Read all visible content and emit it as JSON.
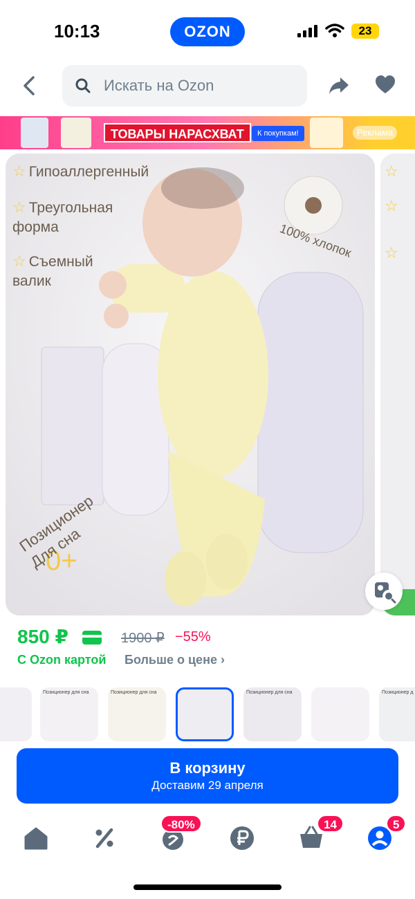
{
  "status_bar": {
    "time": "10:13",
    "brand": "OZON",
    "battery": "23"
  },
  "search": {
    "placeholder": "Искать на Ozon"
  },
  "banner": {
    "headline": "ТОВАРЫ НАРАСХВАТ",
    "cta": "К покупкам!",
    "ad_label": "Реклама"
  },
  "photo": {
    "features": [
      "Гипоаллергенный",
      "Треугольная форма",
      "Съемный валик"
    ],
    "badge_cotton": "100% хлопок",
    "badge_age": "0+",
    "badge_caption": "Позиционер Для сна"
  },
  "price": {
    "current": "850 ₽",
    "old": "1900 ₽",
    "discount": "−55%",
    "card_label": "С Ozon картой",
    "more_label": "Больше о цене"
  },
  "thumbnails": [
    "",
    "Позиционер для сна",
    "Позиционер для сна",
    "",
    "Позиционер для сна",
    "",
    "Позиционер д"
  ],
  "cart_button": {
    "label": "В корзину",
    "delivery": "Доставим 29 апреля"
  },
  "nav": {
    "items": [
      "home",
      "discounts",
      "fresh",
      "finance",
      "cart",
      "profile"
    ],
    "badges": {
      "fresh": "-80%",
      "cart": "14",
      "profile": "5"
    }
  },
  "colors": {
    "accent": "#005bff",
    "price_green": "#10c44c",
    "discount_pink": "#f91155"
  }
}
